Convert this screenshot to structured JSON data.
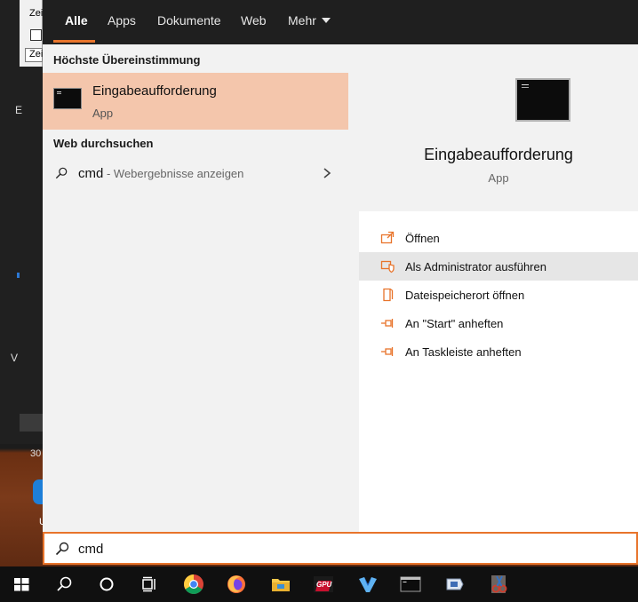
{
  "background": {
    "dialog_title_partial": "Zei",
    "dialog_field_partial": "Zei",
    "left_letter_b": "E",
    "left_letter_v": "V",
    "bottom_number_partial": "30",
    "desktop_icon_label_partial": "U"
  },
  "tabs": [
    {
      "label": "Alle",
      "active": true
    },
    {
      "label": "Apps"
    },
    {
      "label": "Dokumente"
    },
    {
      "label": "Web"
    },
    {
      "label": "Mehr"
    }
  ],
  "best_match": {
    "section_title": "Höchste Übereinstimmung",
    "name": "Eingabeaufforderung",
    "type": "App"
  },
  "web_search": {
    "section_title": "Web durchsuchen",
    "query": "cmd",
    "separator": " - ",
    "hint": "Webergebnisse anzeigen"
  },
  "detail": {
    "name": "Eingabeaufforderung",
    "type": "App",
    "actions": [
      {
        "label": "Öffnen",
        "icon": "open-icon"
      },
      {
        "label": "Als Administrator ausführen",
        "icon": "admin-shield-icon"
      },
      {
        "label": "Dateispeicherort öffnen",
        "icon": "file-location-icon"
      },
      {
        "label": "An \"Start\" anheften",
        "icon": "pin-icon"
      },
      {
        "label": "An Taskleiste anheften",
        "icon": "pin-icon"
      }
    ]
  },
  "search_box": {
    "value": "cmd"
  },
  "taskbar": {
    "items": [
      "windows-start-icon",
      "search-icon",
      "cortana-icon",
      "task-view-icon",
      "chrome-icon",
      "firefox-icon",
      "file-explorer-icon",
      "gpu-z-icon",
      "visual-studio-icon",
      "command-prompt-icon",
      "app-icon",
      "snipping-tool-icon"
    ],
    "gpu_label": "GPU"
  },
  "colors": {
    "accent": "#e8742b",
    "selected_item": "#f4c6ac",
    "tab_bar": "#1f1f1f",
    "taskbar": "#101010"
  }
}
